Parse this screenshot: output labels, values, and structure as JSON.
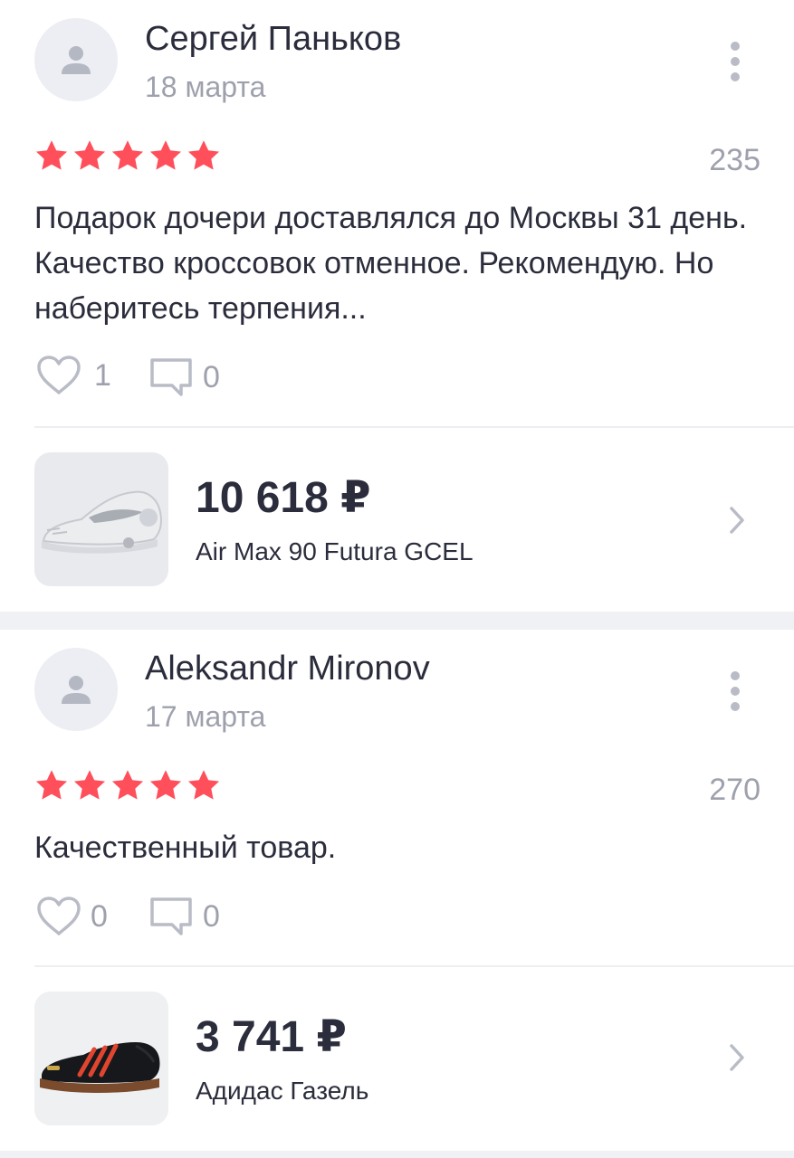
{
  "reviews": [
    {
      "author": "Сергей Паньков",
      "date": "18 марта",
      "rating": 5,
      "count": "235",
      "text": "Подарок дочери доставлялся до Москвы 31 день. Качество кроссовок отменное. Рекомендую. Но наберитесь терпения...",
      "likes": "1",
      "comments": "0",
      "product": {
        "price": "10 618 ₽",
        "name": "Air Max 90 Futura GCEL",
        "image": "white-sneaker-image"
      }
    },
    {
      "author": "Aleksandr Mironov",
      "date": "17 марта",
      "rating": 5,
      "count": "270",
      "text": "Качественный товар.",
      "likes": "0",
      "comments": "0",
      "product": {
        "price": "3 741 ₽",
        "name": "Адидас Газель",
        "image": "black-red-sneaker-image"
      }
    }
  ],
  "colors": {
    "star": "#ff4f5a",
    "muted": "#9ea1ad",
    "text": "#2b2d3c",
    "background": "#f0f1f5"
  }
}
